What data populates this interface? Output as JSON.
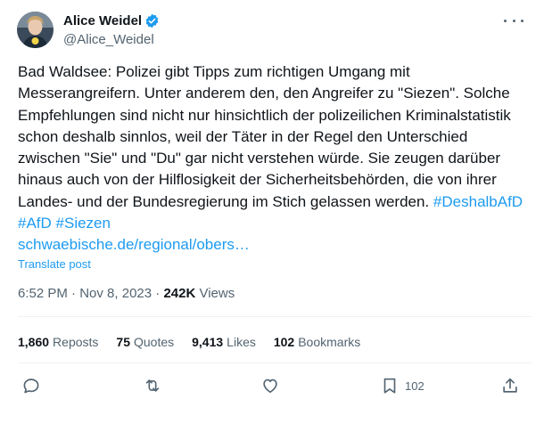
{
  "author": {
    "name": "Alice Weidel",
    "handle": "@Alice_Weidel"
  },
  "tweet": {
    "text": "Bad Waldsee: Polizei gibt Tipps zum richtigen Umgang mit Messerangreifern. Unter anderem den, den Angreifer zu \"Siezen\". Solche Empfehlungen sind nicht nur hinsichtlich der polizeilichen Kriminalstatistik schon deshalb sinnlos, weil der Täter in der Regel den Unterschied zwischen \"Sie\" und \"Du\" gar nicht verstehen würde. Sie zeugen darüber hinaus auch von der Hilflosigkeit der Sicherheitsbehörden, die von ihrer Landes- und der Bundesregierung im Stich gelassen werden.",
    "hashtags": [
      "#DeshalbAfD",
      "#AfD",
      "#Siezen"
    ],
    "link": "schwaebische.de/regional/obers…",
    "translate_label": "Translate post"
  },
  "meta": {
    "time": "6:52 PM",
    "date": "Nov 8, 2023",
    "separator": "·",
    "views_count": "242K",
    "views_label": "Views"
  },
  "stats": {
    "reposts_count": "1,860",
    "reposts_label": "Reposts",
    "quotes_count": "75",
    "quotes_label": "Quotes",
    "likes_count": "9,413",
    "likes_label": "Likes",
    "bookmarks_count": "102",
    "bookmarks_label": "Bookmarks"
  },
  "actions": {
    "bookmark_count": "102"
  },
  "colors": {
    "text": "#0f1419",
    "secondary": "#536471",
    "accent": "#1d9bf0",
    "divider": "#eff3f4"
  },
  "icons": [
    "avatar",
    "verified-badge-icon",
    "more-icon",
    "reply-icon",
    "repost-icon",
    "like-icon",
    "bookmark-icon",
    "share-icon"
  ]
}
